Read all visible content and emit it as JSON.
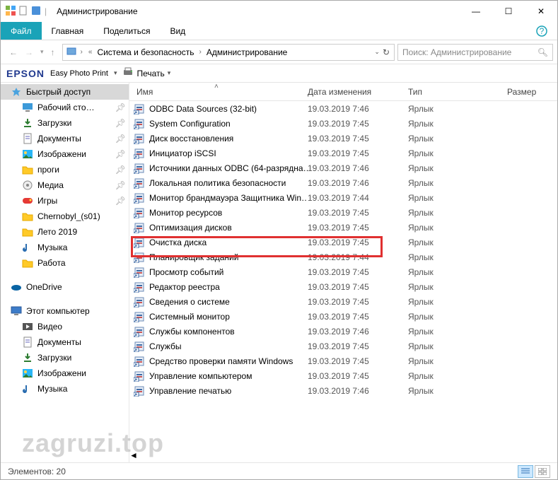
{
  "title": "Администрирование",
  "tabs": {
    "file": "Файл",
    "home": "Главная",
    "share": "Поделиться",
    "view": "Вид"
  },
  "breadcrumb": [
    "Система и безопасность",
    "Администрирование"
  ],
  "search_placeholder": "Поиск: Администрирование",
  "epson": {
    "logo": "EPSON",
    "text": "Easy Photo Print",
    "print": "Печать"
  },
  "sidebar": {
    "quick": {
      "header": "Быстрый доступ",
      "items": [
        {
          "label": "Рабочий сто…",
          "pin": true,
          "icon": "desktop"
        },
        {
          "label": "Загрузки",
          "pin": true,
          "icon": "downloads"
        },
        {
          "label": "Документы",
          "pin": true,
          "icon": "documents"
        },
        {
          "label": "Изображени",
          "pin": true,
          "icon": "pictures"
        },
        {
          "label": "проги",
          "pin": true,
          "icon": "folder"
        },
        {
          "label": "Медиа",
          "pin": true,
          "icon": "media"
        },
        {
          "label": "Игры",
          "pin": true,
          "icon": "games"
        },
        {
          "label": "Chernobyl_(s01)",
          "pin": false,
          "icon": "folder"
        },
        {
          "label": "Лето 2019",
          "pin": false,
          "icon": "folder"
        },
        {
          "label": "Музыка",
          "pin": false,
          "icon": "music"
        },
        {
          "label": "Работа",
          "pin": false,
          "icon": "folder"
        }
      ]
    },
    "onedrive": "OneDrive",
    "thispc": {
      "header": "Этот компьютер",
      "items": [
        {
          "label": "Видео",
          "icon": "video"
        },
        {
          "label": "Документы",
          "icon": "documents"
        },
        {
          "label": "Загрузки",
          "icon": "downloads"
        },
        {
          "label": "Изображени",
          "icon": "pictures"
        },
        {
          "label": "Музыка",
          "icon": "music"
        }
      ]
    }
  },
  "columns": {
    "name": "Имя",
    "date": "Дата изменения",
    "type": "Тип",
    "size": "Размер"
  },
  "files": [
    {
      "name": "ODBC Data Sources (32-bit)",
      "date": "19.03.2019 7:46",
      "type": "Ярлык"
    },
    {
      "name": "System Configuration",
      "date": "19.03.2019 7:45",
      "type": "Ярлык"
    },
    {
      "name": "Диск восстановления",
      "date": "19.03.2019 7:45",
      "type": "Ярлык"
    },
    {
      "name": "Инициатор iSCSI",
      "date": "19.03.2019 7:45",
      "type": "Ярлык"
    },
    {
      "name": "Источники данных ODBC (64-разрядна…",
      "date": "19.03.2019 7:46",
      "type": "Ярлык"
    },
    {
      "name": "Локальная политика безопасности",
      "date": "19.03.2019 7:46",
      "type": "Ярлык"
    },
    {
      "name": "Монитор брандмауэра Защитника Win…",
      "date": "19.03.2019 7:44",
      "type": "Ярлык"
    },
    {
      "name": "Монитор ресурсов",
      "date": "19.03.2019 7:45",
      "type": "Ярлык"
    },
    {
      "name": "Оптимизация дисков",
      "date": "19.03.2019 7:45",
      "type": "Ярлык"
    },
    {
      "name": "Очистка диска",
      "date": "19.03.2019 7:45",
      "type": "Ярлык"
    },
    {
      "name": "Планировщик заданий",
      "date": "19.03.2019 7:44",
      "type": "Ярлык"
    },
    {
      "name": "Просмотр событий",
      "date": "19.03.2019 7:45",
      "type": "Ярлык"
    },
    {
      "name": "Редактор реестра",
      "date": "19.03.2019 7:45",
      "type": "Ярлык"
    },
    {
      "name": "Сведения о системе",
      "date": "19.03.2019 7:45",
      "type": "Ярлык"
    },
    {
      "name": "Системный монитор",
      "date": "19.03.2019 7:45",
      "type": "Ярлык"
    },
    {
      "name": "Службы компонентов",
      "date": "19.03.2019 7:46",
      "type": "Ярлык"
    },
    {
      "name": "Службы",
      "date": "19.03.2019 7:45",
      "type": "Ярлык"
    },
    {
      "name": "Средство проверки памяти Windows",
      "date": "19.03.2019 7:45",
      "type": "Ярлык"
    },
    {
      "name": "Управление компьютером",
      "date": "19.03.2019 7:45",
      "type": "Ярлык"
    },
    {
      "name": "Управление печатью",
      "date": "19.03.2019 7:46",
      "type": "Ярлык"
    }
  ],
  "status": "Элементов: 20",
  "watermark": "zagruzi.top"
}
